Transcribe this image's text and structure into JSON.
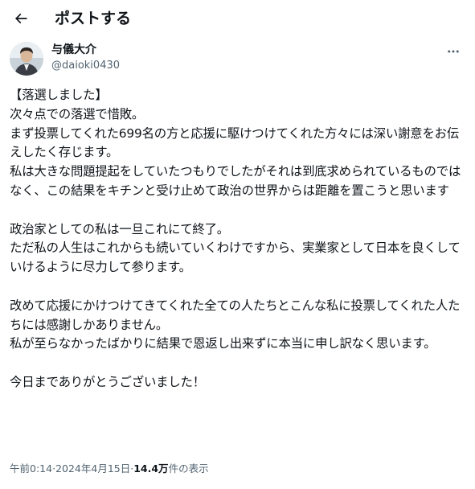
{
  "header": {
    "title": "ポストする",
    "back_icon": "arrow-left-icon"
  },
  "author": {
    "display_name": "与儀大介",
    "handle": "@daioki0430",
    "more_icon": "more-horizontal-icon"
  },
  "post": {
    "lines": [
      "【落選しました】",
      "次々点での落選で惜敗。",
      "まず投票してくれた699名の方と応援に駆けつけてくれた方々には深い謝意をお伝えしたく存じます。",
      "私は大きな問題提起をしていたつもりでしたがそれは到底求められているものではなく、この結果をキチンと受け止めて政治の世界からは距離を置こうと思います",
      "",
      "政治家としての私は一旦これにて終了。",
      "ただ私の人生はこれからも続いていくわけですから、実業家として日本を良くしていけるように尽力して参ります。",
      "",
      "改めて応援にかけつけてきてくれた全ての人たちとこんな私に投票してくれた人たちには感謝しかありません。",
      "私が至らなかったばかりに結果で恩返し出来ずに本当に申し訳なく思います。",
      "",
      "今日までありがとうございました！"
    ]
  },
  "meta": {
    "time": "午前0:14",
    "separator": " · ",
    "date": "2024年4月15日",
    "views_count": "14.4万",
    "views_label": " 件の表示"
  },
  "colors": {
    "text": "#0f1419",
    "secondary": "#536471",
    "background": "#ffffff"
  }
}
